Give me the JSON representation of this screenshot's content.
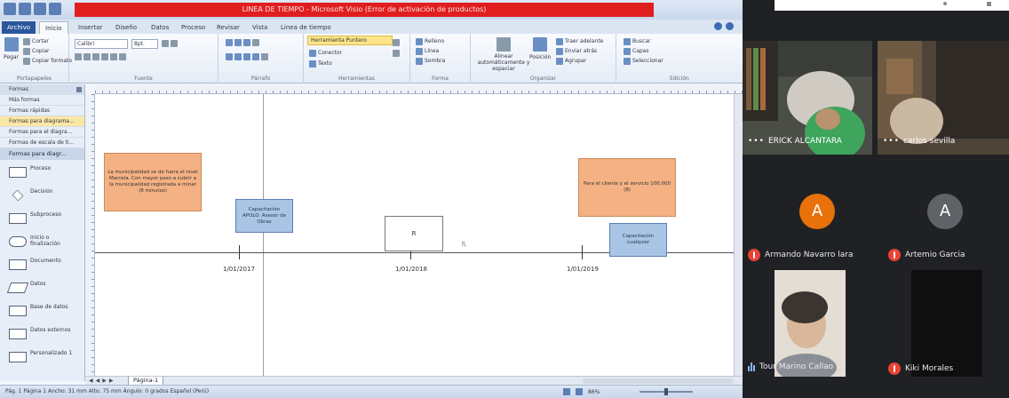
{
  "visio": {
    "title_banner": "LINEA DE TIEMPO - Microsoft Visio (Error de activación de productos)",
    "tabs": [
      "Archivo",
      "Inicio",
      "Insertar",
      "Diseño",
      "Datos",
      "Proceso",
      "Revisar",
      "Vista",
      "Linea de tiempo"
    ],
    "ribbon": {
      "clipboard": {
        "paste": "Pegar",
        "cut": "Cortar",
        "copy": "Copiar",
        "format_painter": "Copiar formato",
        "label": "Portapapeles"
      },
      "font": {
        "name": "Calibri",
        "size": "8pt.",
        "label": "Fuente"
      },
      "paragraph_label": "Párrafo",
      "tools": {
        "pointer": "Herramienta Puntero",
        "connector": "Conector",
        "text": "Texto",
        "label": "Herramientas"
      },
      "shape": {
        "fill": "Relleno",
        "line": "Línea",
        "shadow": "Sombra",
        "label": "Forma"
      },
      "arrange": {
        "auto_align": "Alinear automáticamente y espaciar",
        "position": "Posición",
        "bring_front": "Traer adelante",
        "send_back": "Enviar atrás",
        "group": "Agrupar",
        "label": "Organizar"
      },
      "editing": {
        "find": "Buscar",
        "layers": "Capas",
        "select": "Seleccionar",
        "label": "Edición"
      }
    },
    "shapes_panel": {
      "header": "Formas",
      "links": [
        "Más formas",
        "Formas rápidas",
        "Formas para diagrama...",
        "Formas para el diagra...",
        "Formas de escala de ti..."
      ],
      "stencil_title": "Formas para diagr...",
      "items": [
        "Proceso",
        "Decisión",
        "Subproceso",
        "Inicio o finalización",
        "Documento",
        "Datos",
        "Base de datos",
        "Datos externos",
        "Personalizado 1"
      ]
    },
    "canvas": {
      "boxes": [
        {
          "text": "La municipalidad se de fuera el nivel Marcela. Con mayor paso a cubrir a la municipalidad registrada a minar (8 minutos)"
        },
        {
          "text": "Capacitación APOLO. Asesor de Obras"
        },
        {
          "text": "R"
        },
        {
          "text": "Para el cliente y el servicio 100,000 (8)"
        },
        {
          "text": "Capacitación cualquier"
        }
      ],
      "dates": [
        "1/01/2017",
        "1/01/2018",
        "1/01/2019"
      ],
      "cursor_label": "l\\"
    },
    "page_tab": "Página-1",
    "status": "Pág. 1 Página 1   Ancho: 31 mm   Alto: 75 mm   Ángulo: 0 grados   Español (Perú)",
    "zoom": "86%"
  },
  "meet": {
    "participants": [
      {
        "name": "ERICK ALCANTARA"
      },
      {
        "name": "carlos sevilla"
      },
      {
        "name": "Armando Navarro lara",
        "initial": "A",
        "color": "#e8710a"
      },
      {
        "name": "Artemio Garcia",
        "initial": "A",
        "color": "#5f6368"
      },
      {
        "name": "Tour Marino Callao"
      },
      {
        "name": "Kiki Morales"
      }
    ]
  }
}
